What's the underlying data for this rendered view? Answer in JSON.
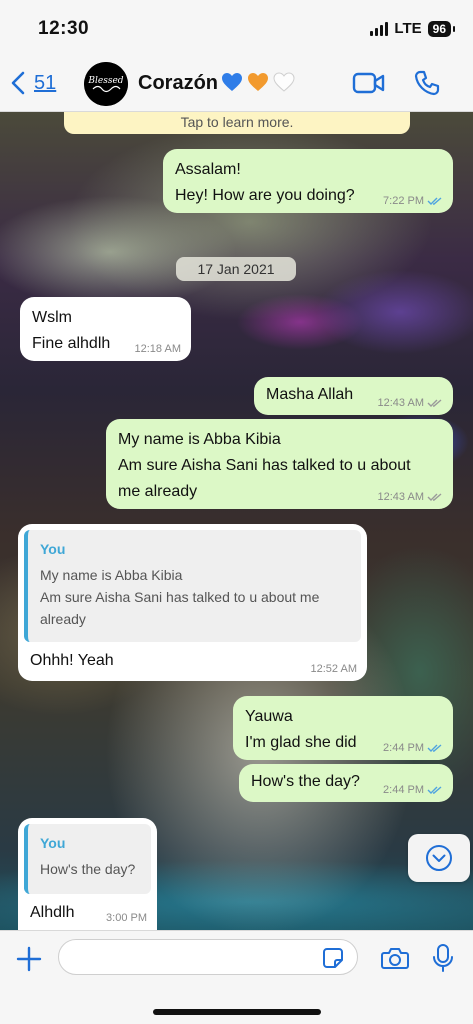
{
  "status": {
    "time": "12:30",
    "network": "LTE",
    "battery": "96"
  },
  "header": {
    "back_count": "51",
    "contact_name": "Corazón",
    "hearts": [
      "blue-heart",
      "orange-heart",
      "white-heart"
    ],
    "avatar_text": "Blessed"
  },
  "chat": {
    "encryption_notice": "Tap to learn more.",
    "date_chip": "17 Jan 2021",
    "messages": [
      {
        "dir": "out",
        "lines": [
          "Assalam!",
          "Hey! How are you doing?"
        ],
        "time": "7:22 PM",
        "status": "read"
      },
      {
        "dir": "in",
        "lines": [
          "Wslm",
          "Fine alhdlh"
        ],
        "time": "12:18 AM"
      },
      {
        "dir": "out",
        "lines": [
          "Masha Allah"
        ],
        "time": "12:43 AM",
        "status": "delivered"
      },
      {
        "dir": "out",
        "lines": [
          "My name is Abba Kibia",
          "Am sure Aisha Sani has talked to u about",
          "me already"
        ],
        "time": "12:43 AM",
        "status": "delivered"
      },
      {
        "dir": "in",
        "quote": {
          "author": "You",
          "lines": [
            "My name is Abba Kibia",
            "Am sure Aisha Sani has talked to u about me",
            "already"
          ]
        },
        "lines": [
          "Ohhh! Yeah"
        ],
        "time": "12:52 AM"
      },
      {
        "dir": "out",
        "lines": [
          "Yauwa",
          "I'm glad she did"
        ],
        "time": "2:44 PM",
        "status": "read"
      },
      {
        "dir": "out",
        "lines": [
          "How's the day?"
        ],
        "time": "2:44 PM",
        "status": "read"
      },
      {
        "dir": "in",
        "quote": {
          "author": "You",
          "lines": [
            "How's the day?"
          ]
        },
        "lines": [
          "Alhdlh"
        ],
        "time": "3:00 PM"
      }
    ]
  },
  "composer": {
    "input_value": "",
    "placeholder": ""
  },
  "colors": {
    "accent": "#1f6ed6",
    "outgoing": "#dcf8c6",
    "incoming": "#ffffff",
    "read_ticks": "#4fa3e0",
    "quote_bar": "#3fa7d6"
  }
}
